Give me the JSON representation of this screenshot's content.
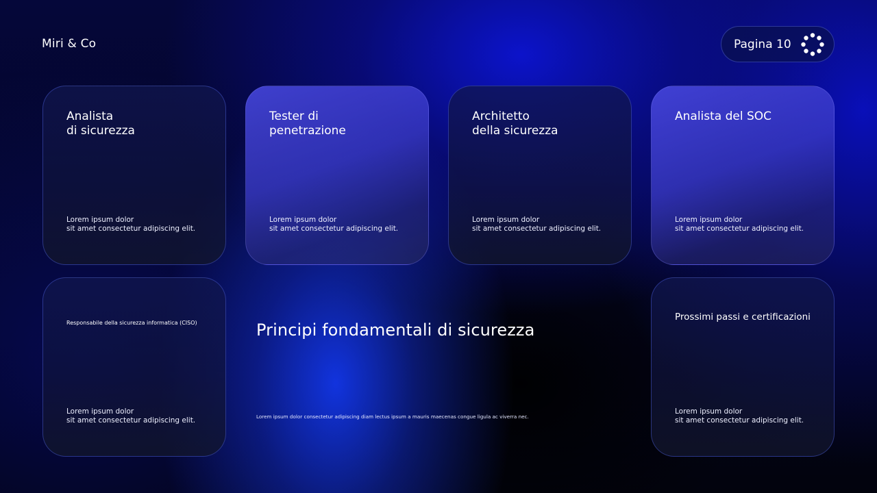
{
  "header": {
    "brand": "Miri & Co",
    "page_label": "Pagina 10"
  },
  "cards": [
    {
      "title": "Analista\ndi sicurezza",
      "description": "Lorem ipsum dolor\nsit amet consectetur adipiscing elit."
    },
    {
      "title": "Tester di\npenetrazione",
      "description": "Lorem ipsum dolor\nsit amet consectetur adipiscing elit."
    },
    {
      "title": "Architetto\ndella sicurezza",
      "description": "Lorem ipsum dolor\nsit amet consectetur adipiscing elit."
    },
    {
      "title": "Analista del SOC",
      "description": "Lorem ipsum dolor\nsit amet consectetur adipiscing elit."
    },
    {
      "title": "Responsabile della sicurezza informatica (CISO)",
      "description": "Lorem ipsum dolor\nsit amet consectetur adipiscing elit."
    },
    {
      "title": "Prossimi passi e certificazioni",
      "description": "Lorem ipsum dolor\nsit amet consectetur adipiscing elit."
    }
  ],
  "main": {
    "title": "Principi fondamentali di sicurezza",
    "description": "Lorem ipsum dolor consectetur adipiscing diam lectus ipsum a mauris maecenas congue ligula ac viverra nec."
  },
  "icons": {
    "spinner": "loading-dots-icon"
  }
}
